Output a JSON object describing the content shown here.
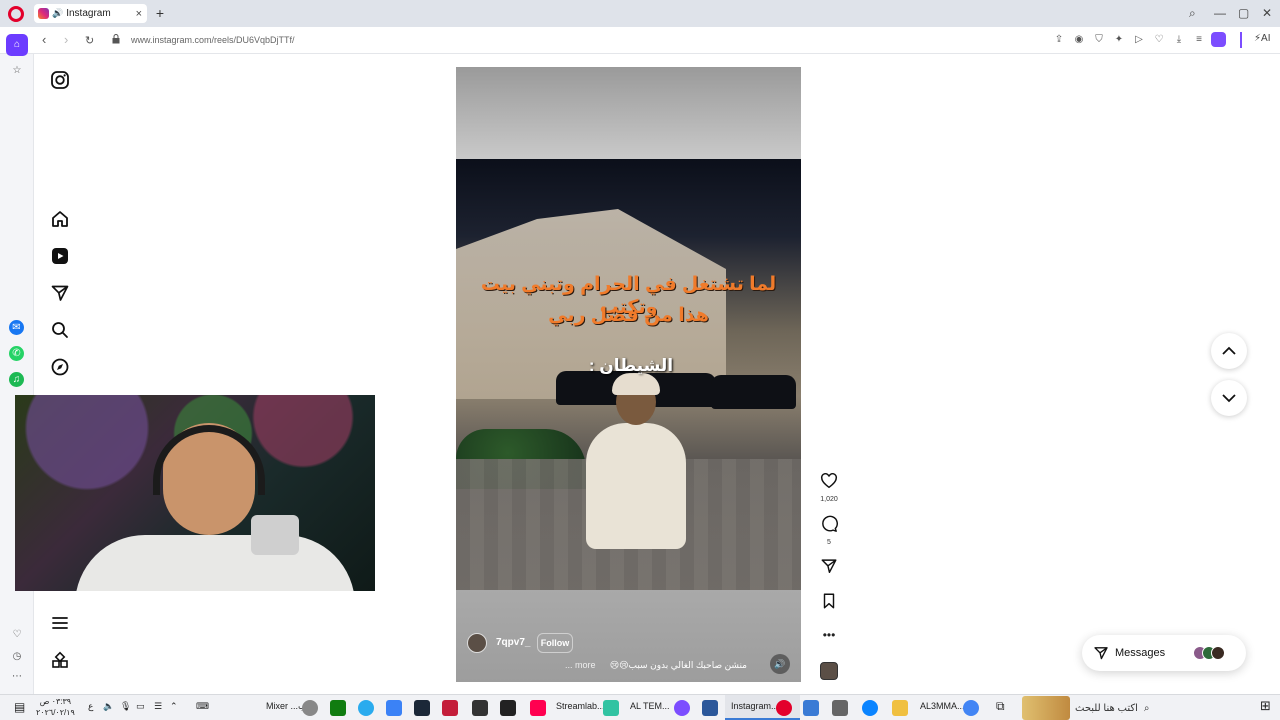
{
  "browser": {
    "tab_title": "Instagram",
    "tab_close": "×",
    "new_tab": "+",
    "url": "www.instagram.com/reels/DU6VqbDjTTf/",
    "ai_label": "AI",
    "controls": {
      "minimize": "—",
      "maximize": "▢",
      "close": "✕"
    }
  },
  "reel": {
    "caption_line1": "لما تشتغل في الحرام وتبني بيت وتكتب",
    "caption_line2": "هذا من فضل ربي",
    "caption_line3": "الشيطان :",
    "author": "7qpv7_",
    "follow_label": "Follow",
    "description": "منشن صاحبك الغالي بدون سبب😢😢",
    "more_label": "... more",
    "likes": "1,020",
    "comments": "5"
  },
  "messages": {
    "label": "Messages"
  },
  "taskbar": {
    "clock_time": "٠٣:٣٩ ص",
    "clock_date": "٢٠٢٦/٠٢/١٩",
    "search_placeholder": "اكتب هنا للبحث",
    "apps": [
      {
        "label": "Mixer ...ب"
      },
      {
        "label": "Streamlab..."
      },
      {
        "label": "AL TEM..."
      },
      {
        "label": "Instagram..."
      },
      {
        "label": "AL3MMA..."
      }
    ],
    "lang": "ع"
  },
  "colors": {
    "caption_orange": "#f07b2b",
    "opera_red": "#e3002b",
    "profile_purple": "#7c4dff"
  }
}
